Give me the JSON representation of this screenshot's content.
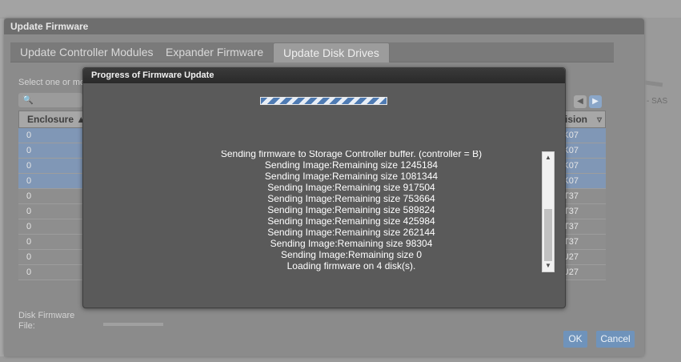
{
  "update_firmware": {
    "title": "Update Firmware",
    "tabs": [
      {
        "label": "Update Controller Modules",
        "active": false
      },
      {
        "label": "Expander Firmware",
        "active": false
      },
      {
        "label": "Update Disk Drives",
        "active": true
      }
    ],
    "select_label": "Select one or mo",
    "grid": {
      "headers": [
        "Enclosure",
        "vision"
      ],
      "rows": [
        {
          "enclosure": "0",
          "revision": "K07",
          "selected": true
        },
        {
          "enclosure": "0",
          "revision": "K07",
          "selected": true
        },
        {
          "enclosure": "0",
          "revision": "K07",
          "selected": true
        },
        {
          "enclosure": "0",
          "revision": "K07",
          "selected": true
        },
        {
          "enclosure": "0",
          "revision": "T37",
          "selected": false
        },
        {
          "enclosure": "0",
          "revision": "T37",
          "selected": false
        },
        {
          "enclosure": "0",
          "revision": "T37",
          "selected": false
        },
        {
          "enclosure": "0",
          "revision": "T37",
          "selected": false
        },
        {
          "enclosure": "0",
          "revision": "U27",
          "selected": false
        },
        {
          "enclosure": "0",
          "revision": "U27",
          "selected": false
        }
      ]
    },
    "disk_firmware_label": "Disk Firmware File:",
    "ok_label": "OK",
    "cancel_label": "Cancel",
    "side_text": "- SAS"
  },
  "progress_modal": {
    "title": "Progress of Firmware Update",
    "progress_fraction": 0.5,
    "log": [
      "Sending firmware to Storage Controller buffer. (controller = B)",
      "Sending Image:Remaining size 1245184",
      "Sending Image:Remaining size 1081344",
      "Sending Image:Remaining size 917504",
      "Sending Image:Remaining size 753664",
      "Sending Image:Remaining size 589824",
      "Sending Image:Remaining size 425984",
      "Sending Image:Remaining size 262144",
      "Sending Image:Remaining size 98304",
      "Sending Image:Remaining size 0",
      "Loading firmware on 4 disk(s)."
    ]
  },
  "colors": {
    "accent": "#4f7bb3",
    "selected_row": "#8097b6",
    "button": "#6f93bb"
  }
}
